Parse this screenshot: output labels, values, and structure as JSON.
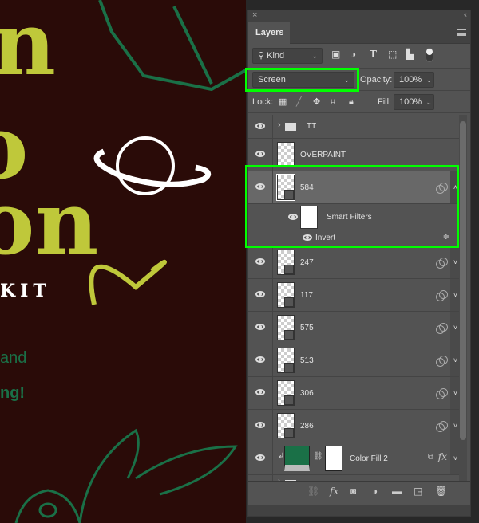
{
  "canvas": {
    "text_fragments": [
      "n",
      "o",
      "on",
      "KIT",
      "and",
      "ng!"
    ],
    "colors": {
      "background": "#2a0b08",
      "lime": "#bfc83a",
      "green": "#1a7047",
      "white": "#ffffff"
    }
  },
  "panel": {
    "tab_label": "Layers",
    "filter": {
      "kind_label": "Kind",
      "icons": [
        "pixel-filter-icon",
        "adjustment-filter-icon",
        "type-filter-icon",
        "shape-filter-icon",
        "smart-object-filter-icon",
        "filter-toggle"
      ]
    },
    "blend_mode": "Screen",
    "opacity_label": "Opacity:",
    "opacity_value": "100%",
    "lock_label": "Lock:",
    "fill_label": "Fill:",
    "fill_value": "100%",
    "layers": [
      {
        "name": "TT",
        "type": "group"
      },
      {
        "name": "OVERPAINT",
        "type": "pixel"
      },
      {
        "name": "584",
        "type": "smart",
        "selected": true,
        "expanded": true
      },
      {
        "name": "247",
        "type": "smart"
      },
      {
        "name": "117",
        "type": "smart"
      },
      {
        "name": "575",
        "type": "smart"
      },
      {
        "name": "513",
        "type": "smart"
      },
      {
        "name": "306",
        "type": "smart"
      },
      {
        "name": "286",
        "type": "smart"
      },
      {
        "name": "Color Fill 2",
        "type": "fill",
        "color": "#1a7047"
      }
    ],
    "smart_filters_label": "Smart Filters",
    "invert_label": "Invert",
    "highlight_color": "#00ff00"
  }
}
